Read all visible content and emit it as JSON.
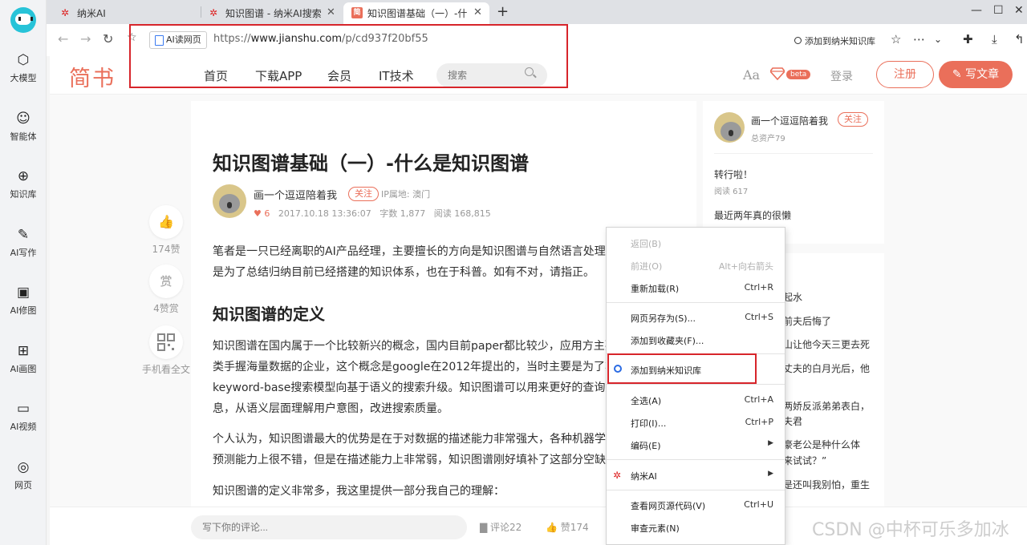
{
  "sidebar": {
    "items": [
      {
        "label": "大模型",
        "icon": "cube-icon"
      },
      {
        "label": "智能体",
        "icon": "agent-icon"
      },
      {
        "label": "知识库",
        "icon": "knowledge-icon"
      },
      {
        "label": "AI写作",
        "icon": "pen-icon"
      },
      {
        "label": "AI修图",
        "icon": "image-edit-icon"
      },
      {
        "label": "AI画图",
        "icon": "image-add-icon"
      },
      {
        "label": "AI视频",
        "icon": "video-icon"
      },
      {
        "label": "网页",
        "icon": "globe-icon"
      }
    ]
  },
  "tabs": [
    {
      "title": "纳米AI",
      "active": false
    },
    {
      "title": "知识图谱 - 纳米AI搜索",
      "active": false
    },
    {
      "title": "知识图谱基础（一）-什么是",
      "active": true
    }
  ],
  "toolbar": {
    "read_label": "AI读网页",
    "url_prefix": "https://",
    "url_host": "www.jianshu.com",
    "url_path": "/p/cd937f20bf55",
    "add_kb_label": "添加到纳米知识库"
  },
  "site": {
    "logo": "简书",
    "nav": [
      "首页",
      "下载APP",
      "会员",
      "IT技术"
    ],
    "search_placeholder": "搜索",
    "font_label": "Aa",
    "beta": "beta",
    "login": "登录",
    "signup": "注册",
    "write": "写文章"
  },
  "side_actions": {
    "like_count": "174赞",
    "reward_glyph": "赏",
    "reward_count": "4赞赏",
    "mobile_label": "手机看全文"
  },
  "article": {
    "title": "知识图谱基础（一）-什么是知识图谱",
    "author": "画一个逗逗陪着我",
    "follow": "关注",
    "ip": "IP属地: 澳门",
    "hearts": "6",
    "date": "2017.10.18 13:36:07",
    "words": "字数 1,877",
    "reads": "阅读 168,815",
    "p1_l1": "笔者是一只已经离职的AI产品经理，主要擅长的方向是知识图谱与自然语言处理，",
    "p1_l2": "是为了总结归纳目前已经搭建的知识体系，也在于科普。如有不对，请指正。",
    "h2": "知识图谱的定义",
    "p2_l1": "知识图谱在国内属于一个比较新兴的概念，国内目前paper都比较少，应用方主要",
    "p2_l2": "类手握海量数据的企业，这个概念是google在2012年提出的，当时主要是为了将",
    "p2_l3": "keyword-base搜索模型向基于语义的搜索升级。知识图谱可以用来更好的查询复",
    "p2_l4": "息，从语义层面理解用户意图，改进搜索质量。",
    "p3_l1": "个人认为，知识图谱最大的优势是在于对数据的描述能力非常强大，各种机器学",
    "p3_l2": "预测能力上很不错，但是在描述能力上非常弱，知识图谱刚好填补了这部分空缺。",
    "p4": "知识图谱的定义非常多，我这里提供一部分我自己的理解："
  },
  "aside": {
    "author": "画一个逗逗陪着我",
    "follow": "关注",
    "assets": "总资产79",
    "posts": [
      {
        "title": "转行啦！",
        "reads": "阅读 617"
      },
      {
        "title": "最近两年真的很懒",
        "reads": ""
      }
    ],
    "recommend_fragments": [
      "起水",
      "前夫后悔了",
      "山让他今天三更去死",
      "丈夫的白月光后，他",
      "两娇反派弟弟表白，",
      "夫君",
      "豪老公是种什么体",
      "来试试？”",
      "是还叫我别怕，重生"
    ]
  },
  "comment_bar": {
    "placeholder": "写下你的评论...",
    "comments": "评论22",
    "likes": "赞174"
  },
  "watermark": "CSDN @中杯可乐多加冰",
  "context_menu": [
    {
      "label": "返回(B)",
      "shortcut": "",
      "disabled": true
    },
    {
      "label": "前进(O)",
      "shortcut": "Alt+向右箭头",
      "disabled": true
    },
    {
      "label": "重新加载(R)",
      "shortcut": "Ctrl+R",
      "disabled": false
    },
    {
      "label": "网页另存为(S)...",
      "shortcut": "Ctrl+S",
      "disabled": false
    },
    {
      "label": "添加到收藏夹(F)...",
      "shortcut": "",
      "disabled": false
    },
    {
      "label": "添加到纳米知识库",
      "shortcut": "",
      "disabled": false
    },
    {
      "label": "全选(A)",
      "shortcut": "Ctrl+A",
      "disabled": false
    },
    {
      "label": "打印(I)...",
      "shortcut": "Ctrl+P",
      "disabled": false
    },
    {
      "label": "编码(E)",
      "shortcut": "",
      "disabled": false
    },
    {
      "label": "纳米AI",
      "shortcut": "",
      "disabled": false
    },
    {
      "label": "查看网页源代码(V)",
      "shortcut": "Ctrl+U",
      "disabled": false
    },
    {
      "label": "审查元素(N)",
      "shortcut": "",
      "disabled": false
    }
  ],
  "colors": {
    "brand": "#ea6f5a",
    "highlight_box": "#d7252b",
    "kb_icon": "#2a6be3"
  }
}
